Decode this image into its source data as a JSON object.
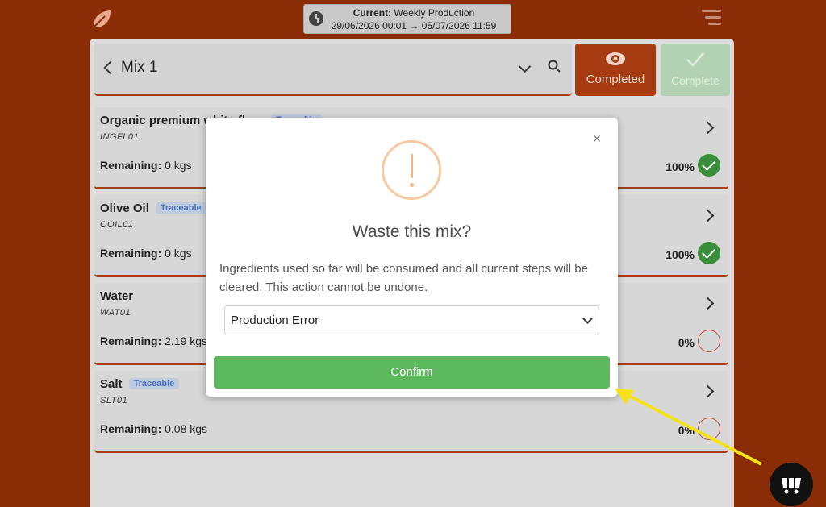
{
  "period": {
    "label": "Current:",
    "name": "Weekly Production",
    "range": "29/06/2026 00:01 → 05/07/2026 11:59"
  },
  "header": {
    "mix_title": "Mix 1",
    "completed_label": "Completed",
    "complete_label": "Complete"
  },
  "items": [
    {
      "name": "Organic premium white flour",
      "badge": "Traceable",
      "code": "INGFL01",
      "remaining_label": "Remaining:",
      "remaining": "0 kgs",
      "percent": "100%",
      "done": true
    },
    {
      "name": "Olive Oil",
      "badge": "Traceable",
      "code": "OOIL01",
      "remaining_label": "Remaining:",
      "remaining": "0 kgs",
      "percent": "100%",
      "done": true
    },
    {
      "name": "Water",
      "badge": "",
      "code": "WAT01",
      "remaining_label": "Remaining:",
      "remaining": "2.19 kgs",
      "percent": "0%",
      "done": false
    },
    {
      "name": "Salt",
      "badge": "Traceable",
      "code": "SLT01",
      "remaining_label": "Remaining:",
      "remaining": "0.08 kgs",
      "percent": "0%",
      "done": false
    }
  ],
  "modal": {
    "title": "Waste this mix?",
    "text": "Ingredients used so far will be consumed and all current steps will be cleared. This action cannot be undone.",
    "reason_selected": "Production Error",
    "confirm_label": "Confirm"
  },
  "colors": {
    "brand": "#8a2d07",
    "accent": "#a93d11",
    "success": "#5cb85c",
    "warning": "#f5b27a",
    "annotation": "#f5e21a"
  }
}
